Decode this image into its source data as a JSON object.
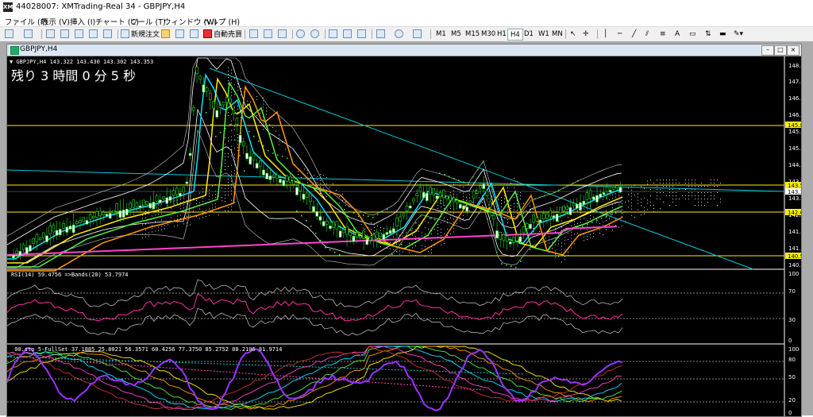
{
  "window": {
    "title": "44028007: XMTrading-Real 34 - GBPJPY,H4",
    "icon_text": "XM"
  },
  "menu": [
    {
      "label": "ファイル (F)"
    },
    {
      "label": "表示 (V)"
    },
    {
      "label": "挿入 (I)"
    },
    {
      "label": "チャート (C)"
    },
    {
      "label": "ツール (T)"
    },
    {
      "label": "ウィンドウ (W)"
    },
    {
      "label": "ヘルプ (H)"
    }
  ],
  "toolbar": {
    "new_order_label": "新規注文",
    "auto_trade_label": "自動売買",
    "timeframes": [
      "M1",
      "M5",
      "M15",
      "M30",
      "H1",
      "H4",
      "D1",
      "W1",
      "MN"
    ],
    "active_timeframe": "H4"
  },
  "chart_window": {
    "title": "GBPJPY,H4",
    "min": "–",
    "max": "□",
    "close": "×"
  },
  "chart": {
    "header": "▼ GBPJPY,H4  143.322 143.430 143.302 143.353",
    "countdown": "残り 3 時間 0 分 5 秒",
    "price_axis": [
      "148.130",
      "147.515",
      "146.885",
      "146.270",
      "145.640",
      "145.025",
      "144.395",
      "143.780",
      "143.165",
      "142.550",
      "141.920",
      "141.290",
      "140.675"
    ],
    "level_labels": [
      {
        "text": "145.858",
        "color": "#ffee00"
      },
      {
        "text": "143.569",
        "color": "#ffee00"
      },
      {
        "text": "143.353",
        "color": "#ffffff"
      },
      {
        "text": "142.602",
        "color": "#ffee00"
      },
      {
        "text": "140.957",
        "color": "#ffee00"
      }
    ]
  },
  "rsi": {
    "header": "RSI(14) 59.4756  =>Bands(20) 53.7974",
    "axis": [
      "100",
      "70",
      "30",
      "0"
    ]
  },
  "stoch": {
    "header": "_00.sto_5-FullSet 37.1885 25.8021 56.3571 60.4256 77.3750 85.2752 88.2106 81.9714",
    "axis": [
      "100",
      "80",
      "50",
      "20",
      "0"
    ]
  },
  "colors": {
    "bg": "#000000",
    "yellow_line": "#ffee00",
    "cyan": "#00e5ff",
    "magenta": "#ff44cc",
    "rsi": "#ff2fa0",
    "stoch_main": "#9933ff"
  }
}
